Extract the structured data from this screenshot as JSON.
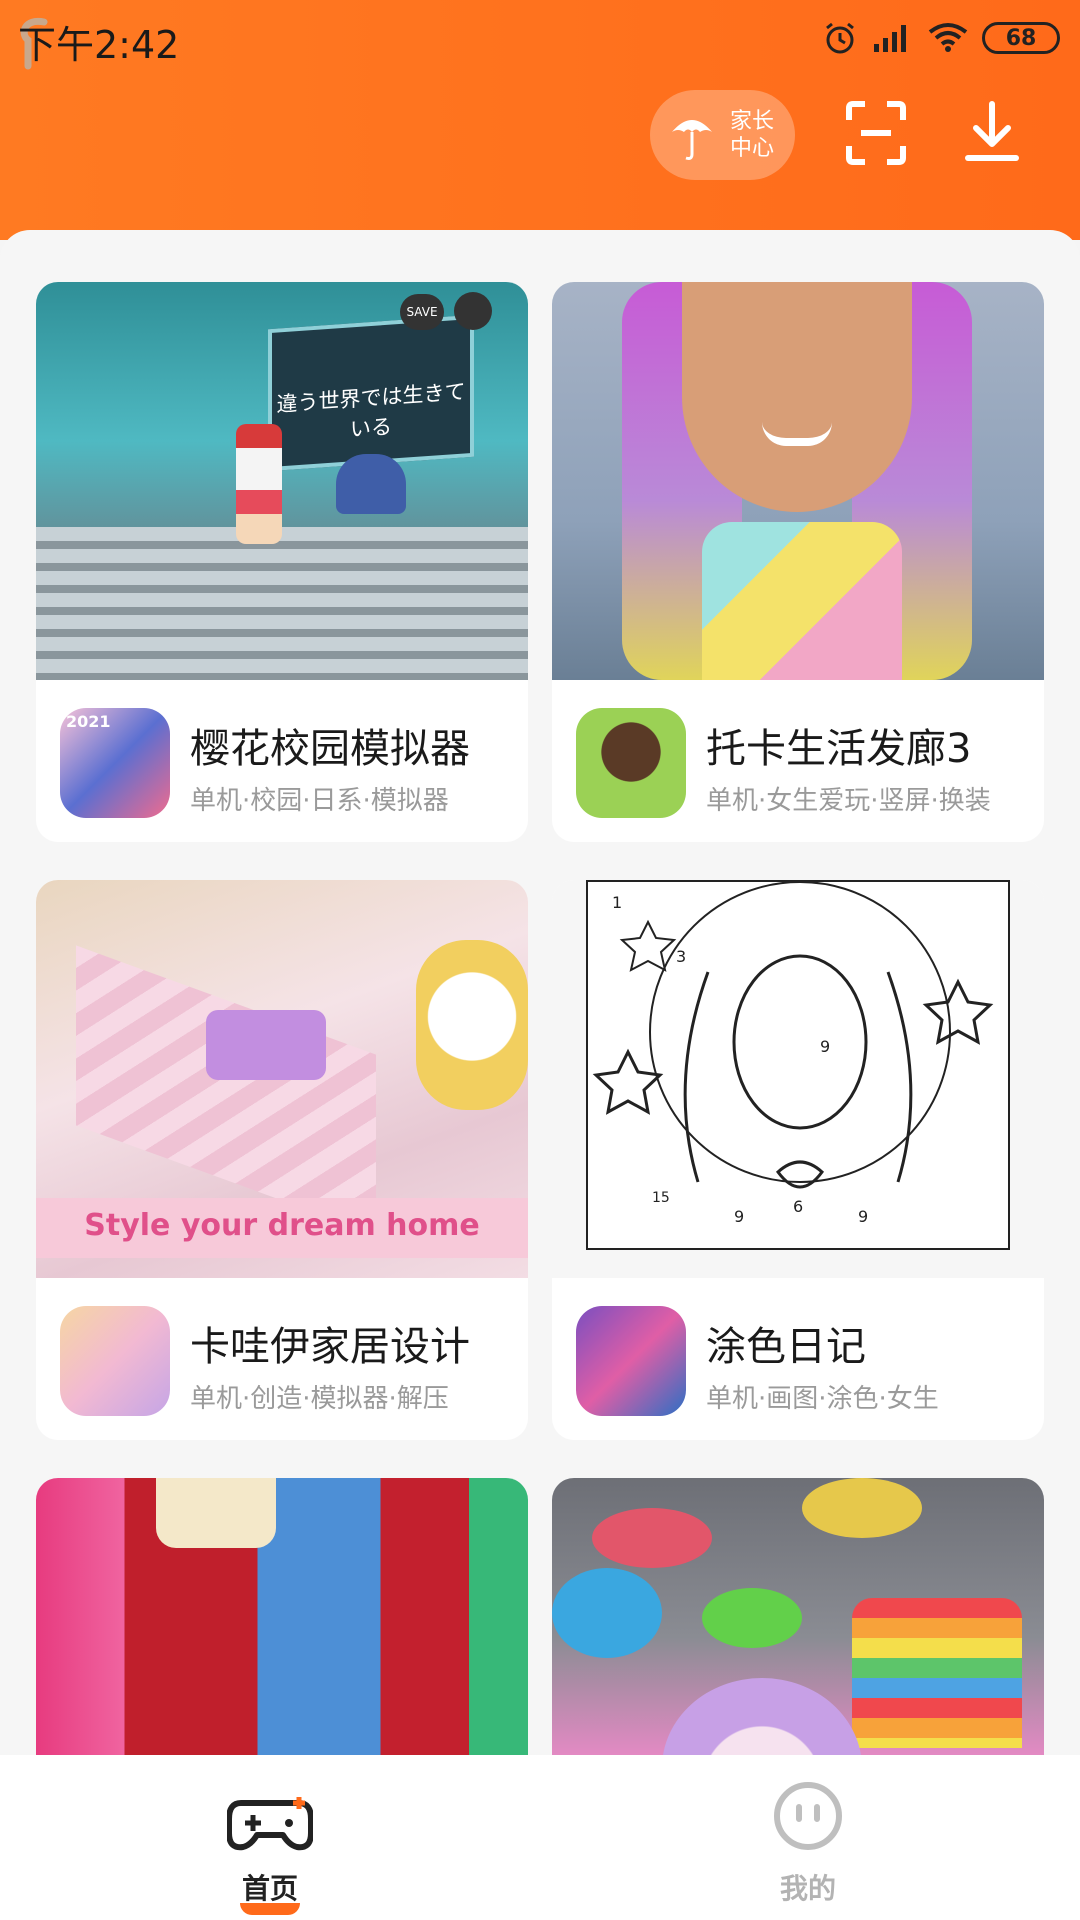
{
  "status_bar": {
    "time": "下午2:42",
    "battery": "68"
  },
  "header": {
    "parent_center_label": "家长\n中心",
    "scan_icon": "scan-icon",
    "download_icon": "download-icon",
    "accent_color": "#ff6a1a"
  },
  "games": [
    {
      "name": "樱花校园模拟器",
      "tags": "单机·校园·日系·模拟器",
      "banner_text": "違う世界では生きている",
      "banner_overlay": "SAVE"
    },
    {
      "name": "托卡生活发廊3",
      "tags": "单机·女生爱玩·竖屏·换装"
    },
    {
      "name": "卡哇伊家居设计",
      "tags": "单机·创造·模拟器·解压",
      "banner_text": "Style your dream home"
    },
    {
      "name": "涂色日记",
      "tags": "单机·画图·涂色·女生"
    },
    {
      "name": "",
      "tags": ""
    },
    {
      "name": "",
      "tags": ""
    }
  ],
  "tabbar": {
    "home_label": "首页",
    "mine_label": "我的"
  }
}
